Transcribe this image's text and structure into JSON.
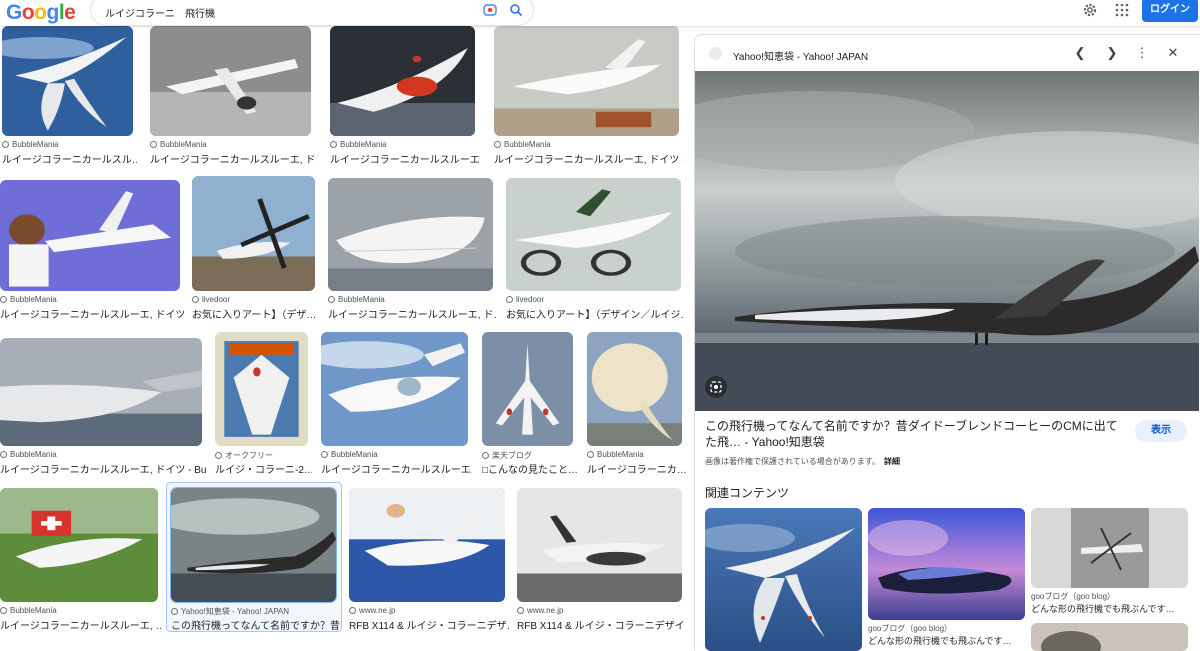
{
  "header": {
    "logo": "Google",
    "query": "ルイジコラーニ　飛行機",
    "login_label": "ログイン"
  },
  "results": [
    {
      "source": "BubbleMania",
      "title": "ルイージコラーニカールスル…"
    },
    {
      "source": "BubbleMania",
      "title": "ルイージコラーニカールスルーエ, ド…"
    },
    {
      "source": "BubbleMania",
      "title": "ルイージコラーニカールスルーエ, …"
    },
    {
      "source": "BubbleMania",
      "title": "ルイージコラーニカールスルーエ, ドイツ - …"
    },
    {
      "source": "BubbleMania",
      "title": "ルイージコラーニカールスルーエ, ドイツ…"
    },
    {
      "source": "livedoor",
      "title": "お気に入りアート】（デザ…"
    },
    {
      "source": "BubbleMania",
      "title": "ルイージコラーニカールスルーエ, ド…"
    },
    {
      "source": "livedoor",
      "title": "お気に入りアート】（デザイン／ルイジ…"
    },
    {
      "source": "BubbleMania",
      "title": "ルイージコラーニカールスルーエ, ドイツ - Bu…"
    },
    {
      "source": "オークフリー",
      "title": "ルイジ・コラーニ-2…"
    },
    {
      "source": "BubbleMania",
      "title": "ルイージコラーニカールスルーエ, ドイツ…"
    },
    {
      "source": "楽天ブログ",
      "title": "□こんなの見たこと…"
    },
    {
      "source": "BubbleMania",
      "title": "ルイージコラーニカ…"
    },
    {
      "source": "BubbleMania",
      "title": "ルイージコラーニカールスルーエ, …"
    },
    {
      "source": "Yahoo!知恵袋 - Yahoo! JAPAN",
      "title": "この飛行機ってなんて名前ですか？昔…"
    },
    {
      "source": "www.ne.jp",
      "title": "RFB X114 & ルイジ・コラーニデザ…"
    },
    {
      "source": "www.ne.jp",
      "title": "RFB X114 & ルイジ・コラーニデザイ…"
    }
  ],
  "panel": {
    "site": "Yahoo!知恵袋 - Yahoo! JAPAN",
    "title": "この飛行機ってなんて名前ですか？昔ダイドーブレンドコーヒーのCMに出てた飛… - Yahoo!知恵袋",
    "view_label": "表示",
    "copyright": "画像は著作権で保護されている場合があります。",
    "details_label": "詳細",
    "related_heading": "関連コンテンツ",
    "related": [
      {
        "source": "gooブログ（goo blog）",
        "title": "どんな形の飛行機でも飛ぶんです…"
      },
      {
        "source": "gooブログ（goo blog）",
        "title": "どんな形の飛行機でも飛ぶんです…"
      }
    ]
  },
  "colors": {
    "accent": "#1a73e8",
    "selected_border": "#a8c7fa"
  }
}
